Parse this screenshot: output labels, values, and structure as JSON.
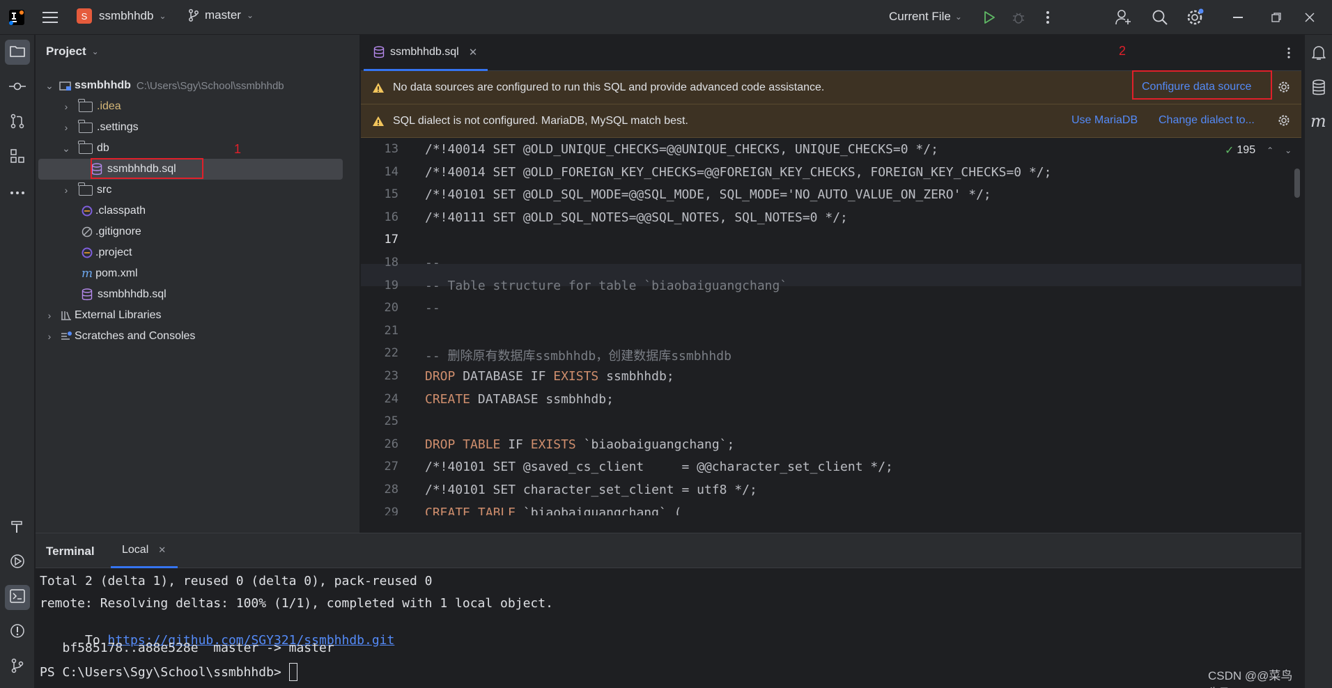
{
  "titlebar": {
    "project_badge": "S",
    "project_name": "ssmbhhdb",
    "branch": "master",
    "run_config": "Current File"
  },
  "project_panel": {
    "title": "Project",
    "root_name": "ssmbhhdb",
    "root_path": "C:\\Users\\Sgy\\School\\ssmbhhdb",
    "items": [
      {
        "label": ".idea"
      },
      {
        "label": ".settings"
      },
      {
        "label": "db"
      },
      {
        "label": "ssmbhhdb.sql"
      },
      {
        "label": "src"
      },
      {
        "label": ".classpath"
      },
      {
        "label": ".gitignore"
      },
      {
        "label": ".project"
      },
      {
        "label": "pom.xml"
      },
      {
        "label": "ssmbhhdb.sql"
      },
      {
        "label": "External Libraries"
      },
      {
        "label": "Scratches and Consoles"
      }
    ]
  },
  "editor": {
    "tab_label": "ssmbhhdb.sql",
    "banner1": {
      "text": "No data sources are configured to run this SQL and provide advanced code assistance.",
      "action": "Configure data source"
    },
    "banner2": {
      "text": "SQL dialect is not configured. MariaDB, MySQL match best.",
      "action1": "Use MariaDB",
      "action2": "Change dialect to..."
    },
    "inspection_count": "195",
    "lines": [
      {
        "n": "13",
        "t": "/*!40014 SET @OLD_UNIQUE_CHECKS=@@UNIQUE_CHECKS, UNIQUE_CHECKS=0 */;"
      },
      {
        "n": "14",
        "t": "/*!40014 SET @OLD_FOREIGN_KEY_CHECKS=@@FOREIGN_KEY_CHECKS, FOREIGN_KEY_CHECKS=0 */;"
      },
      {
        "n": "15",
        "t": "/*!40101 SET @OLD_SQL_MODE=@@SQL_MODE, SQL_MODE='NO_AUTO_VALUE_ON_ZERO' */;"
      },
      {
        "n": "16",
        "t": "/*!40111 SET @OLD_SQL_NOTES=@@SQL_NOTES, SQL_NOTES=0 */;"
      },
      {
        "n": "17",
        "t": ""
      },
      {
        "n": "18",
        "t": "--"
      },
      {
        "n": "19",
        "t": "-- Table structure for table `biaobaiguangchang`"
      },
      {
        "n": "20",
        "t": "--"
      },
      {
        "n": "21",
        "t": ""
      },
      {
        "n": "22",
        "t": "-- 删除原有数据库ssmbhhdb，创建数据库ssmbhhdb"
      },
      {
        "n": "23",
        "kw": "DROP",
        "t": " DATABASE IF ",
        "kw2": "EXISTS",
        "t2": " ssmbhhdb;"
      },
      {
        "n": "24",
        "kw": "CREATE",
        "t": " DATABASE ssmbhhdb;"
      },
      {
        "n": "25",
        "t": ""
      },
      {
        "n": "26",
        "kw": "DROP TABLE",
        "t": " IF ",
        "kw2": "EXISTS",
        "t2": " `biaobaiguangchang`;"
      },
      {
        "n": "27",
        "t": "/*!40101 SET @saved_cs_client     = @@character_set_client */;"
      },
      {
        "n": "28",
        "t": "/*!40101 SET character_set_client = utf8 */;"
      },
      {
        "n": "29",
        "kw": "CREATE TABLE",
        "t": " `biaobaiguangchang` ("
      }
    ]
  },
  "terminal": {
    "title": "Terminal",
    "tab": "Local",
    "lines": [
      "Total 2 (delta 1), reused 0 (delta 0), pack-reused 0",
      "remote: Resolving deltas: 100% (1/1), completed with 1 local object."
    ],
    "to_prefix": "To ",
    "to_url": "https://github.com/SGY321/ssmbhhdb.git",
    "push_line": "   bf585178..a88e528e  master -> master",
    "prompt": "PS C:\\Users\\Sgy\\School\\ssmbhhdb> "
  },
  "annotations": {
    "label1": "1",
    "label2": "2"
  },
  "watermark": "CSDN @@菜鸟先飞"
}
